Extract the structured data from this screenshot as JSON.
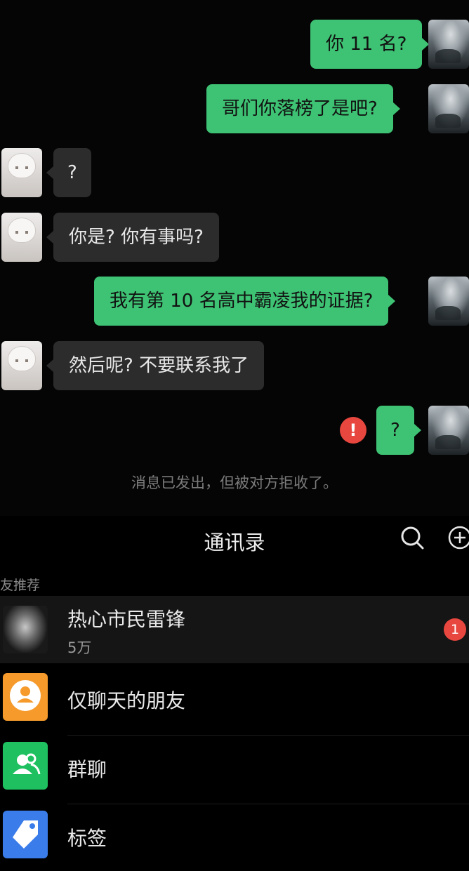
{
  "chat": {
    "messages": [
      {
        "side": "out",
        "text": "你 11 名?"
      },
      {
        "side": "out",
        "text": "哥们你落榜了是吧?"
      },
      {
        "side": "in",
        "text": "?"
      },
      {
        "side": "in",
        "text": "你是? 你有事吗?"
      },
      {
        "side": "out",
        "text": "我有第 10 名高中霸凌我的证据?"
      },
      {
        "side": "in",
        "text": "然后呢?  不要联系我了"
      },
      {
        "side": "out",
        "text": "?",
        "failed": true
      }
    ],
    "error_mark": "!",
    "system_note": "消息已发出，但被对方拒收了。"
  },
  "contacts": {
    "title": "通讯录",
    "search_icon": "search-icon",
    "add_icon": "add-icon",
    "section_label": "朋友推荐",
    "items": [
      {
        "title": "热心市民雷锋",
        "subtitle": "5万",
        "badge": "1",
        "icon": "avatar"
      },
      {
        "title": "仅聊天的朋友",
        "icon": "chat-only-friends-icon",
        "color": "#f59a2b"
      },
      {
        "title": "群聊",
        "icon": "group-chat-icon",
        "color": "#1fc060"
      },
      {
        "title": "标签",
        "icon": "tag-icon",
        "color": "#3a7ce9"
      }
    ]
  },
  "colors": {
    "outgoing_bubble": "#3ec374",
    "incoming_bubble": "#2c2c2c",
    "error": "#e8473f",
    "background": "#000000"
  }
}
